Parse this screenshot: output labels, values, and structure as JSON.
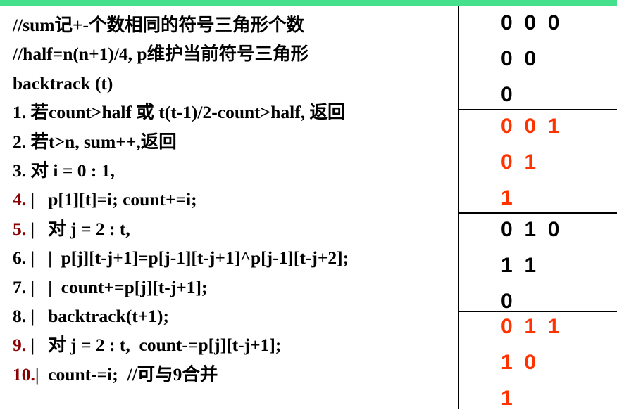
{
  "colors": {
    "accent_bar": "#44e08c",
    "line_number_red": "#8b0000",
    "triangle_red": "#ff3300"
  },
  "code_lines": [
    {
      "num": "",
      "num_red": false,
      "text": "//sum记+-个数相同的符号三角形个数"
    },
    {
      "num": "",
      "num_red": false,
      "text": "//half=n(n+1)/4, p维护当前符号三角形"
    },
    {
      "num": "",
      "num_red": false,
      "text": "backtrack (t)"
    },
    {
      "num": "1.",
      "num_red": false,
      "text": " 若count>half 或 t(t-1)/2-count>half, 返回"
    },
    {
      "num": "2.",
      "num_red": false,
      "text": " 若t>n, sum++,返回"
    },
    {
      "num": "3.",
      "num_red": false,
      "text": " 对 i = 0 : 1,"
    },
    {
      "num": "4.",
      "num_red": true,
      "text": " |   p[1][t]=i; count+=i;"
    },
    {
      "num": "5.",
      "num_red": true,
      "text": " |   对 j = 2 : t,"
    },
    {
      "num": "6.",
      "num_red": false,
      "text": " |   |  p[j][t-j+1]=p[j-1][t-j+1]^p[j-1][t-j+2];"
    },
    {
      "num": "7.",
      "num_red": false,
      "text": " |   |  count+=p[j][t-j+1];"
    },
    {
      "num": "8.",
      "num_red": false,
      "text": " |   backtrack(t+1);"
    },
    {
      "num": "9.",
      "num_red": true,
      "text": " |   对 j = 2 : t,  count-=p[j][t-j+1];"
    },
    {
      "num": "10.",
      "num_red": true,
      "text": "|  count-=i;  //可与9合并"
    }
  ],
  "triangles": [
    {
      "color": "black",
      "rows": [
        "0  0  0",
        "0  0",
        "0"
      ]
    },
    {
      "color": "red",
      "rows": [
        "0  0  1",
        "0  1",
        "1"
      ]
    },
    {
      "color": "black",
      "rows": [
        "0  1  0",
        "1  1",
        "0"
      ]
    },
    {
      "color": "red",
      "rows": [
        "0  1  1",
        "1  0",
        "1"
      ]
    }
  ]
}
